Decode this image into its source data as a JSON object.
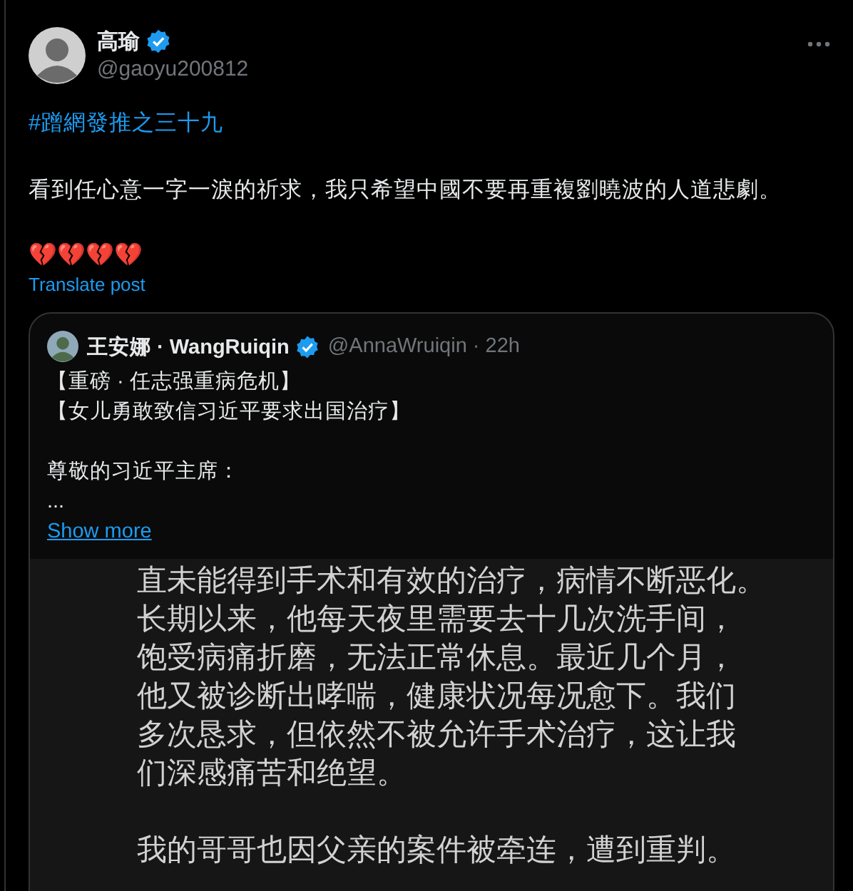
{
  "post": {
    "author": {
      "name": "高瑜",
      "verified": true,
      "handle": "@gaoyu200812"
    },
    "hashtag": "#蹭網發推之三十九",
    "text": "看到任心意一字一淚的祈求，我只希望中國不要再重複劉曉波的人道悲劇。",
    "emoji": "💔💔💔💔",
    "translate": "Translate post"
  },
  "quote": {
    "author": {
      "name": "王安娜 · WangRuiqin",
      "verified": true,
      "handle_time": "@AnnaWruiqin · 22h"
    },
    "paragraphs": [
      [
        "【重磅 · 任志强重病危机】",
        "【女儿勇敢致信习近平要求出国治疗】"
      ],
      [
        "尊敬的习近平主席：",
        "..."
      ]
    ],
    "show_more": "Show more",
    "image": {
      "paragraphs": [
        [
          "直未能得到手术和有效的治疗，病情不断恶化。",
          "长期以来，他每天夜里需要去十几次洗手间，",
          "饱受病痛折磨，无法正常休息。最近几个月，",
          "他又被诊断出哮喘，健康状况每况愈下。我们",
          "多次恳求，但依然不被允许手术治疗，这让我",
          "们深感痛苦和绝望。"
        ],
        [
          "我的哥哥也因父亲的案件被牵连，遭到重判。"
        ]
      ]
    }
  }
}
